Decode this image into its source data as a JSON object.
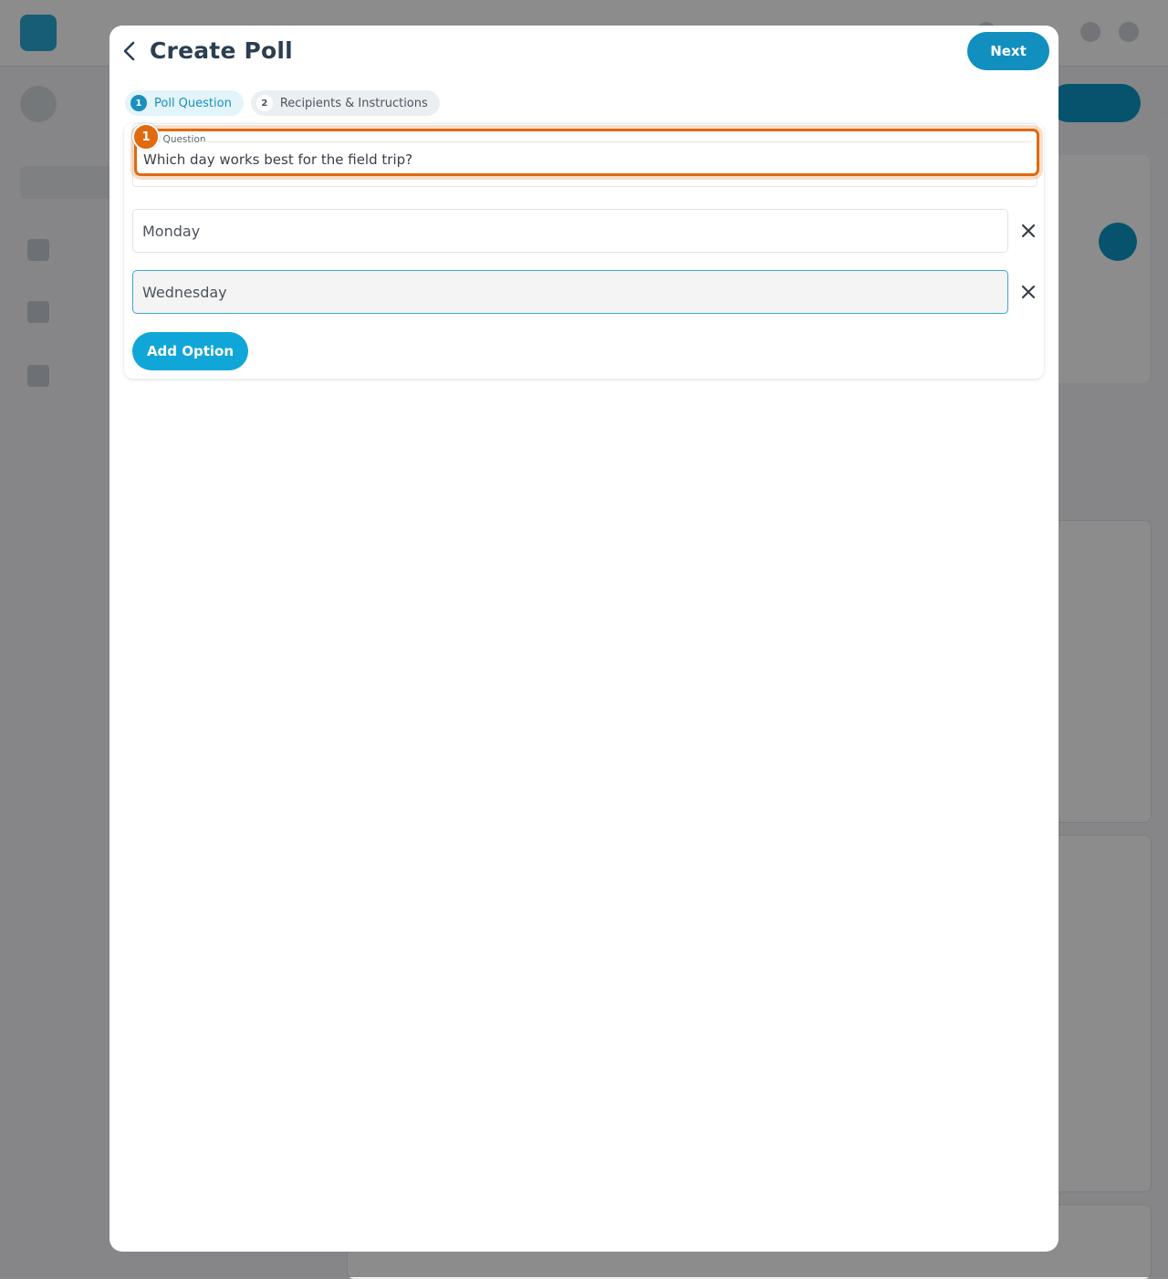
{
  "modal": {
    "title": "Create Poll",
    "next_label": "Next",
    "steps": [
      {
        "number": "1",
        "label": "Poll Question",
        "state": "active"
      },
      {
        "number": "2",
        "label": "Recipients & Instructions",
        "state": "inactive"
      }
    ],
    "question": {
      "label": "Poll Question",
      "value": "Which day works best for the field trip?",
      "highlight_badge": "1",
      "highlight_color": "#e06a10"
    },
    "options": [
      {
        "value": "Monday",
        "focused": false
      },
      {
        "value": "Wednesday",
        "focused": true
      }
    ],
    "add_option_label": "Add Option"
  },
  "colors": {
    "primary": "#118fbf",
    "accent": "#11a6d8",
    "highlight": "#e06a10",
    "title_text": "#2c3e50"
  },
  "icons": {
    "back": "chevron-left-icon",
    "remove": "close-icon"
  }
}
